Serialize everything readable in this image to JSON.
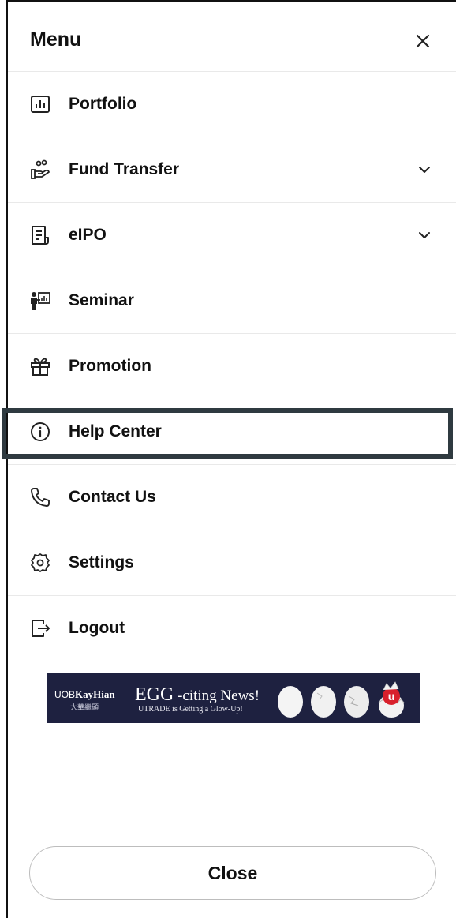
{
  "header": {
    "title": "Menu",
    "close_icon": "close-icon"
  },
  "menu": {
    "items": [
      {
        "label": "Portfolio",
        "icon": "bar-chart-icon",
        "expandable": false
      },
      {
        "label": "Fund Transfer",
        "icon": "hand-coins-icon",
        "expandable": true
      },
      {
        "label": "eIPO",
        "icon": "document-icon",
        "expandable": true
      },
      {
        "label": "Seminar",
        "icon": "presenter-icon",
        "expandable": false
      },
      {
        "label": "Promotion",
        "icon": "gift-icon",
        "expandable": false
      },
      {
        "label": "Help Center",
        "icon": "info-icon",
        "expandable": false,
        "selected": true
      },
      {
        "label": "Contact Us",
        "icon": "phone-icon",
        "expandable": false
      },
      {
        "label": "Settings",
        "icon": "gear-icon",
        "expandable": false
      },
      {
        "label": "Logout",
        "icon": "logout-icon",
        "expandable": false
      }
    ]
  },
  "banner": {
    "brand_prefix": "UOB",
    "brand_name": "KayHian",
    "brand_chinese": "大華繼顯",
    "headline_big": "EGG",
    "headline_rest": " -citing News!",
    "subline": "UTRADE is Getting a Glow-Up!",
    "background": "#1e2140"
  },
  "footer": {
    "close_label": "Close"
  },
  "colors": {
    "selection_border": "#2f3a40",
    "divider": "#e9e9e9",
    "text": "#111111"
  }
}
